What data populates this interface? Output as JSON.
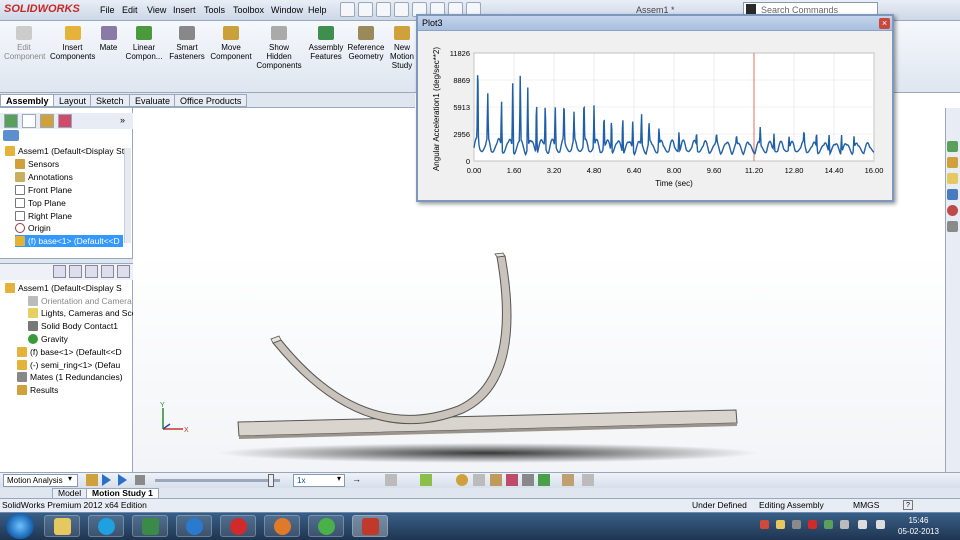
{
  "app": {
    "logo": "SOLIDWORKS",
    "doc_title": "Assem1 *"
  },
  "menu": [
    "File",
    "Edit",
    "View",
    "Insert",
    "Tools",
    "Toolbox",
    "Window",
    "Help"
  ],
  "search": {
    "placeholder": "Search Commands"
  },
  "commands": [
    {
      "label": "Edit\nComponent",
      "disabled": true
    },
    {
      "label": "Insert\nComponents"
    },
    {
      "label": "Mate"
    },
    {
      "label": "Linear\nCompon..."
    },
    {
      "label": "Smart\nFasteners"
    },
    {
      "label": "Move\nComponent"
    },
    {
      "label": "Show\nHidden\nComponents"
    },
    {
      "label": "Assembly\nFeatures"
    },
    {
      "label": "Reference\nGeometry"
    },
    {
      "label": "New\nMotion\nStudy"
    }
  ],
  "cm_tabs": [
    "Assembly",
    "Layout",
    "Sketch",
    "Evaluate",
    "Office Products"
  ],
  "feature_tree": [
    {
      "label": "Assem1  (Default<Display St",
      "icon": "assembly-icon"
    },
    {
      "label": "Sensors",
      "icon": "sensors-icon"
    },
    {
      "label": "Annotations",
      "icon": "annotations-icon"
    },
    {
      "label": "Front Plane",
      "icon": "plane-icon"
    },
    {
      "label": "Top Plane",
      "icon": "plane-icon"
    },
    {
      "label": "Right Plane",
      "icon": "plane-icon"
    },
    {
      "label": "Origin",
      "icon": "origin-icon"
    },
    {
      "label": "(f) base<1> (Default<<D",
      "icon": "part-icon",
      "selected": true
    }
  ],
  "motion_tree": [
    {
      "label": "Assem1  (Default<Display S",
      "icon": "assembly-icon"
    },
    {
      "label": "Orientation and Camera",
      "icon": "camera-icon",
      "gray": true
    },
    {
      "label": "Lights, Cameras and Sce",
      "icon": "lights-icon"
    },
    {
      "label": "Solid Body Contact1",
      "icon": "contact-icon"
    },
    {
      "label": "Gravity",
      "icon": "gravity-icon"
    },
    {
      "label": "(f) base<1> (Default<<D",
      "icon": "part-icon"
    },
    {
      "label": "(-) semi_ring<1> (Defau",
      "icon": "part-icon"
    },
    {
      "label": "Mates (1 Redundancies)",
      "icon": "mates-icon"
    },
    {
      "label": "Results",
      "icon": "results-icon"
    }
  ],
  "plot": {
    "window_title": "Plot3",
    "close": "×"
  },
  "chart_data": {
    "type": "line",
    "title": "",
    "xlabel": "Time (sec)",
    "ylabel": "Angular Acceleration1 (deg/sec**2)",
    "xlim": [
      0,
      16
    ],
    "ylim": [
      0,
      11826
    ],
    "x_ticks": [
      "0.00",
      "1.60",
      "3.20",
      "4.80",
      "6.40",
      "8.00",
      "9.60",
      "11.20",
      "12.80",
      "14.40",
      "16.00"
    ],
    "y_ticks": [
      "0",
      "2956",
      "5913",
      "8869",
      "11826"
    ],
    "marker_x": 11.2,
    "series": [
      {
        "color": "#1f5fa8",
        "peaks": [
          {
            "t": 0.15,
            "v": 11826
          },
          {
            "t": 0.55,
            "v": 7600
          },
          {
            "t": 1.1,
            "v": 6900
          },
          {
            "t": 1.55,
            "v": 9400
          },
          {
            "t": 1.85,
            "v": 9600
          },
          {
            "t": 2.15,
            "v": 8300
          },
          {
            "t": 2.5,
            "v": 7400
          },
          {
            "t": 2.85,
            "v": 6800
          },
          {
            "t": 3.25,
            "v": 6400
          },
          {
            "t": 3.6,
            "v": 7100
          },
          {
            "t": 4.0,
            "v": 5400
          },
          {
            "t": 4.4,
            "v": 7400
          },
          {
            "t": 4.8,
            "v": 6100
          },
          {
            "t": 5.2,
            "v": 5600
          },
          {
            "t": 5.5,
            "v": 5100
          },
          {
            "t": 5.95,
            "v": 5300
          },
          {
            "t": 6.35,
            "v": 4700
          },
          {
            "t": 6.7,
            "v": 5400
          },
          {
            "t": 7.0,
            "v": 4500
          },
          {
            "t": 7.4,
            "v": 3900
          },
          {
            "t": 8.2,
            "v": 3500
          },
          {
            "t": 8.9,
            "v": 3300
          },
          {
            "t": 9.7,
            "v": 3100
          },
          {
            "t": 10.5,
            "v": 2900
          },
          {
            "t": 11.45,
            "v": 3800
          },
          {
            "t": 12.0,
            "v": 3000
          },
          {
            "t": 12.6,
            "v": 2900
          },
          {
            "t": 13.2,
            "v": 3500
          },
          {
            "t": 13.7,
            "v": 3300
          },
          {
            "t": 14.2,
            "v": 3200
          },
          {
            "t": 14.7,
            "v": 3000
          },
          {
            "t": 15.2,
            "v": 2700
          }
        ]
      }
    ]
  },
  "motion": {
    "type": "Motion Analysis",
    "speed": "1x"
  },
  "study_tabs": [
    "Model",
    "Motion Study 1"
  ],
  "status": {
    "edition": "SolidWorks Premium 2012 x64 Edition",
    "state": "Under Defined",
    "mode": "Editing Assembly",
    "units": "MMGS",
    "help": "?"
  },
  "clock": {
    "time": "15:46",
    "date": "05-02-2013"
  },
  "colors": {
    "accent": "#3399ff",
    "plot_line": "#1f5fa8",
    "marker": "#e0705a"
  }
}
